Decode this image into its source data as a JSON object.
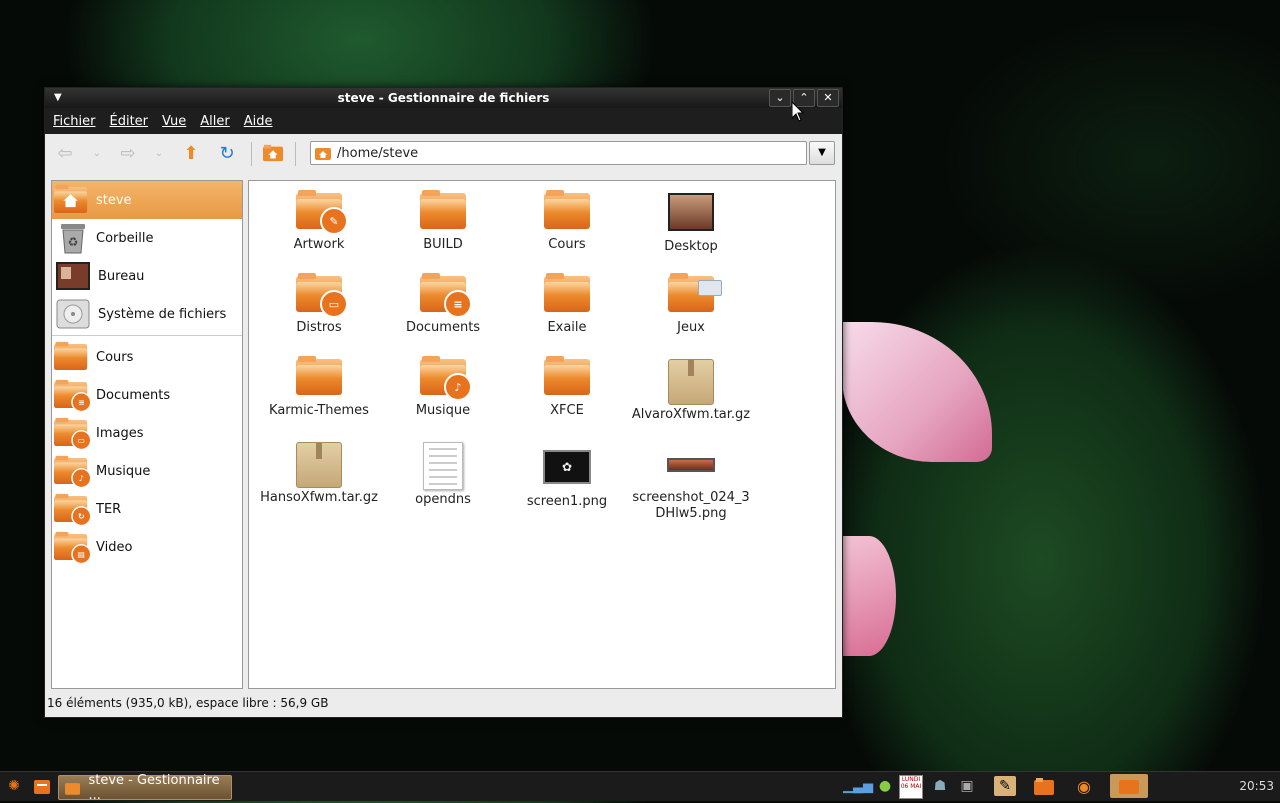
{
  "window": {
    "title": "steve - Gestionnaire de fichiers",
    "menu": [
      {
        "label": "Fichier"
      },
      {
        "label": "Éditer"
      },
      {
        "label": "Vue"
      },
      {
        "label": "Aller"
      },
      {
        "label": "Aide"
      }
    ],
    "address": "/home/steve",
    "status": "16 éléments (935,0 kB), espace libre : 56,9 GB"
  },
  "sidebar": {
    "places": [
      {
        "label": "steve",
        "icon": "home-icon",
        "selected": true
      },
      {
        "label": "Corbeille",
        "icon": "trash-icon"
      },
      {
        "label": "Bureau",
        "icon": "desktop-icon"
      },
      {
        "label": "Système de fichiers",
        "icon": "harddisk-icon"
      }
    ],
    "bookmarks": [
      {
        "label": "Cours",
        "icon": "folder-icon"
      },
      {
        "label": "Documents",
        "icon": "folder-documents-icon"
      },
      {
        "label": "Images",
        "icon": "folder-images-icon"
      },
      {
        "label": "Musique",
        "icon": "folder-music-icon"
      },
      {
        "label": "TER",
        "icon": "folder-ter-icon"
      },
      {
        "label": "Video",
        "icon": "folder-video-icon"
      }
    ]
  },
  "files": [
    {
      "name": "Artwork",
      "type": "folder",
      "emblem": "artwork"
    },
    {
      "name": "BUILD",
      "type": "folder"
    },
    {
      "name": "Cours",
      "type": "folder"
    },
    {
      "name": "Desktop",
      "type": "desktop"
    },
    {
      "name": "Distros",
      "type": "folder",
      "emblem": "distros"
    },
    {
      "name": "Documents",
      "type": "folder",
      "emblem": "documents"
    },
    {
      "name": "Exaile",
      "type": "folder"
    },
    {
      "name": "Jeux",
      "type": "folder",
      "emblem": "jeux"
    },
    {
      "name": "Karmic-Themes",
      "type": "folder"
    },
    {
      "name": "Musique",
      "type": "folder",
      "emblem": "music"
    },
    {
      "name": "XFCE",
      "type": "folder"
    },
    {
      "name": "AlvaroXfwm.tar.gz",
      "type": "archive"
    },
    {
      "name": "HansoXfwm.tar.gz",
      "type": "archive"
    },
    {
      "name": "opendns",
      "type": "text"
    },
    {
      "name": "screen1.png",
      "type": "image"
    },
    {
      "name": "screenshot_024_3DHlw5.png",
      "type": "image-wide"
    }
  ],
  "taskbar": {
    "task_label": "steve - Gestionnaire ...",
    "clock": "20:53",
    "calendar_text": "LUNDI 06 MAI"
  },
  "colors": {
    "accent": "#e8731f",
    "selection": "#f0a858",
    "titlebar": "#1e1e1e"
  }
}
